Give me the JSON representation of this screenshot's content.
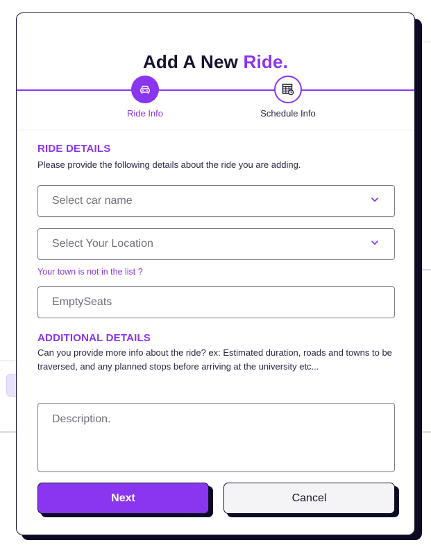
{
  "modal": {
    "title_main": "Add A New ",
    "title_accent": "Ride.",
    "steps": [
      {
        "label": "Ride Info",
        "icon": "car-icon",
        "active": true
      },
      {
        "label": "Schedule Info",
        "icon": "schedule-table-icon",
        "active": false
      }
    ]
  },
  "ride_details": {
    "title": "RIDE DETAILS",
    "description": "Please provide the following details about the ride you are adding.",
    "car_select": {
      "placeholder": "Select car name",
      "icon": "chevron-down-icon"
    },
    "location_select": {
      "placeholder": "Select Your Location",
      "icon": "chevron-down-icon"
    },
    "town_missing_link": "Your town is not in the list ?",
    "empty_seats": {
      "placeholder": "EmptySeats"
    }
  },
  "additional_details": {
    "title": "ADDITIONAL DETAILS",
    "description": "Can you provide more info about the ride? ex: Estimated duration, roads and towns to be traversed, and any planned stops before arriving at the university etc...",
    "description_field": {
      "placeholder": "Description."
    }
  },
  "actions": {
    "next_label": "Next",
    "cancel_label": "Cancel"
  },
  "colors": {
    "accent": "#8a35f0",
    "dark": "#14122e",
    "cancel_bg": "#f4f4f6"
  }
}
